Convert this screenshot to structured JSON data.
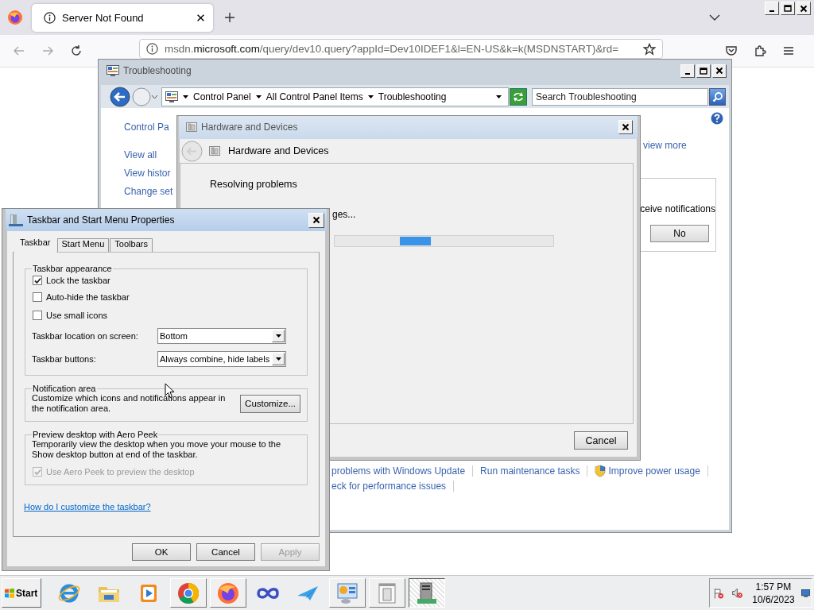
{
  "browser": {
    "tab": {
      "title": "Server Not Found"
    },
    "url": {
      "subdomain": "msdn.",
      "domain": "microsoft.com",
      "path": "/query/dev10.query?appId=Dev10IDEF1&l=EN-US&k=k(MSDNSTART)&rd="
    }
  },
  "troubleshooting": {
    "title": "Troubleshooting",
    "breadcrumb": [
      "Control Panel",
      "All Control Panel Items",
      "Troubleshooting"
    ],
    "search": {
      "placeholder": "Search Troubleshooting"
    },
    "sidebar_links": [
      "Control Pa",
      "View all",
      "View histor",
      "Change set"
    ],
    "view_more": "view more",
    "notice": {
      "text": "ceive notifications",
      "button": "No"
    },
    "task_links": [
      [
        {
          "label": "problems with Windows Update",
          "kind": "plain"
        },
        {
          "label": "Run maintenance tasks",
          "kind": "plain"
        },
        {
          "label": "Improve power usage",
          "kind": "shield"
        }
      ],
      [
        {
          "label": "eck for performance issues",
          "kind": "plain"
        }
      ]
    ]
  },
  "hardware_dialog": {
    "title": "Hardware and Devices",
    "heading": "Hardware and Devices",
    "status": "Resolving problems",
    "detail": "ges...",
    "button": "Cancel"
  },
  "taskbar_properties": {
    "title": "Taskbar and Start Menu Properties",
    "tabs": [
      {
        "label": "Taskbar",
        "selected": true
      },
      {
        "label": "Start Menu",
        "selected": false
      },
      {
        "label": "Toolbars",
        "selected": false
      }
    ],
    "appearance": {
      "legend": "Taskbar appearance",
      "options": [
        {
          "label": "Lock the taskbar",
          "checked": true
        },
        {
          "label": "Auto-hide the taskbar",
          "checked": false
        },
        {
          "label": "Use small icons",
          "checked": false
        }
      ],
      "selects": [
        {
          "label": "Taskbar location on screen:",
          "value": "Bottom"
        },
        {
          "label": "Taskbar buttons:",
          "value": "Always combine, hide labels"
        }
      ]
    },
    "notification": {
      "legend": "Notification area",
      "text": "Customize which icons and notifications appear in the notification area.",
      "button": "Customize..."
    },
    "aero_peek": {
      "legend": "Preview desktop with Aero Peek",
      "text": "Temporarily view the desktop when you move your mouse to the Show desktop button at end of the taskbar.",
      "option": {
        "label": "Use Aero Peek to preview the desktop",
        "checked": true,
        "disabled": true
      }
    },
    "help_link": "How do I customize the taskbar?",
    "buttons": [
      {
        "label": "OK",
        "disabled": false
      },
      {
        "label": "Cancel",
        "disabled": false
      },
      {
        "label": "Apply",
        "disabled": true
      }
    ]
  },
  "taskbar": {
    "start": "Start",
    "apps": [
      {
        "kind": "ie",
        "running": false,
        "selected": false
      },
      {
        "kind": "folder",
        "running": false,
        "selected": false
      },
      {
        "kind": "media",
        "running": false,
        "selected": false
      },
      {
        "kind": "chrome",
        "running": true,
        "selected": false
      },
      {
        "kind": "firefox",
        "running": true,
        "selected": false
      },
      {
        "kind": "infinity",
        "running": false,
        "selected": false
      },
      {
        "kind": "plane",
        "running": false,
        "selected": false
      },
      {
        "kind": "panel",
        "running": true,
        "selected": false
      },
      {
        "kind": "window",
        "running": true,
        "selected": false
      },
      {
        "kind": "server",
        "running": true,
        "selected": true
      }
    ],
    "clock": {
      "time": "1:57 PM",
      "date": "10/6/2023"
    }
  }
}
